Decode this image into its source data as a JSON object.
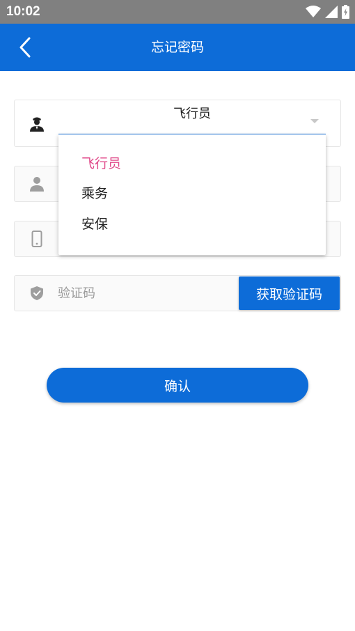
{
  "status_bar": {
    "time": "10:02"
  },
  "app_bar": {
    "title": "忘记密码",
    "back_icon": "chevron-left-icon"
  },
  "form": {
    "role_selector": {
      "icon": "pilot-icon",
      "selected_value": "飞行员"
    },
    "name_field": {
      "icon": "person-icon"
    },
    "phone_field": {
      "icon": "phone-icon"
    },
    "code_field": {
      "icon": "shield-icon",
      "placeholder": "验证码",
      "value": ""
    },
    "get_code_button": "获取验证码",
    "confirm_button": "确认"
  },
  "dropdown": {
    "options": [
      {
        "label": "飞行员",
        "selected": true
      },
      {
        "label": "乘务",
        "selected": false
      },
      {
        "label": "安保",
        "selected": false
      }
    ]
  },
  "colors": {
    "primary": "#0d6cd8",
    "selected_option": "#e04a8a",
    "status_bar": "#808080"
  }
}
